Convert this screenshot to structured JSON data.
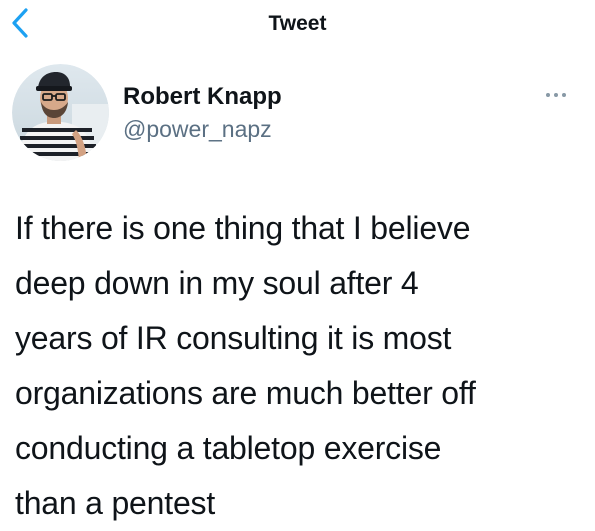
{
  "nav": {
    "title": "Tweet",
    "back_icon": "chevron-left-icon",
    "accent_color": "#1da1f2"
  },
  "author": {
    "display_name": "Robert Knapp",
    "handle": "@power_napz",
    "avatar_icon": "avatar-photo",
    "more_icon": "ellipsis-icon"
  },
  "tweet": {
    "lines": [
      "If there is one thing that I believe",
      "deep down in my soul after 4",
      "years of IR consulting it is most",
      "organizations are much better off",
      "conducting a tabletop exercise",
      "than a pentest"
    ]
  }
}
